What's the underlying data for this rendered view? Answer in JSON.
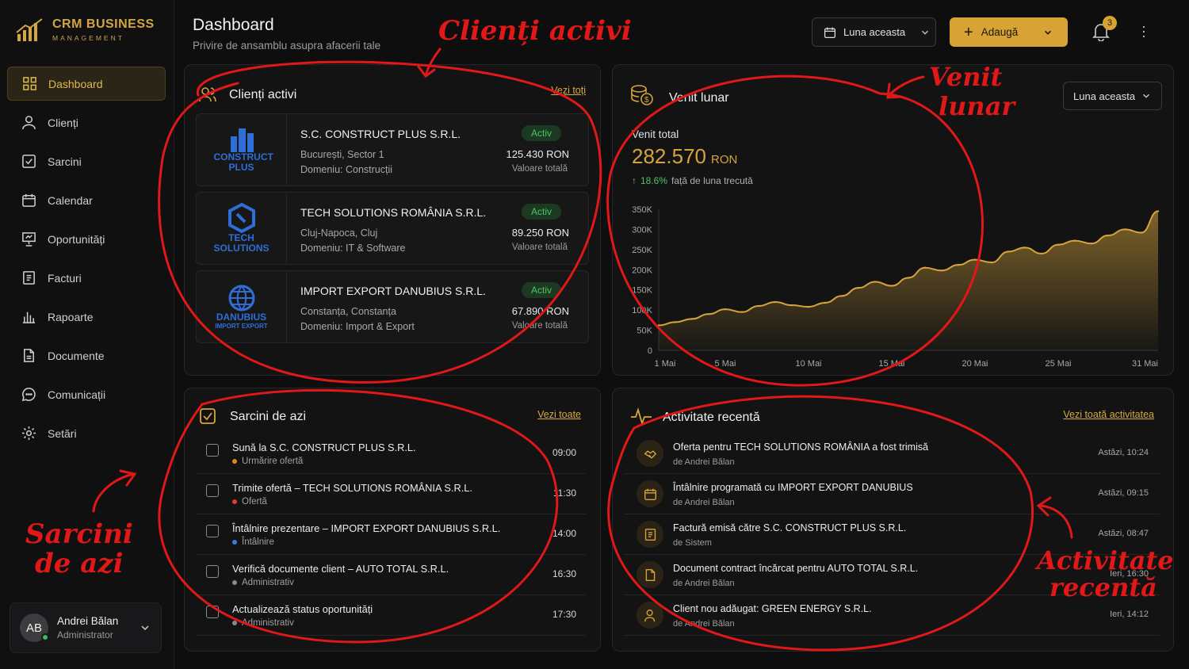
{
  "app": {
    "name": "CRM BUSINESS",
    "subtitle": "MANAGEMENT"
  },
  "nav": [
    {
      "label": "Dashboard",
      "icon": "dashboard-icon",
      "active": true
    },
    {
      "label": "Clienți",
      "icon": "user-icon"
    },
    {
      "label": "Sarcini",
      "icon": "checkbox-icon"
    },
    {
      "label": "Calendar",
      "icon": "calendar-icon"
    },
    {
      "label": "Oportunități",
      "icon": "presentation-icon"
    },
    {
      "label": "Facturi",
      "icon": "invoice-icon"
    },
    {
      "label": "Rapoarte",
      "icon": "bar-chart-icon"
    },
    {
      "label": "Documente",
      "icon": "document-icon"
    },
    {
      "label": "Comunicații",
      "icon": "chat-icon"
    },
    {
      "label": "Setări",
      "icon": "gear-icon"
    }
  ],
  "user": {
    "initials": "AB",
    "name": "Andrei Bălan",
    "role": "Administrator"
  },
  "header": {
    "title": "Dashboard",
    "subtitle": "Privire de ansamblu asupra afacerii tale",
    "period": "Luna aceasta",
    "add": "Adaugă",
    "notifications": "3"
  },
  "clients": {
    "title": "Clienți activi",
    "link": "Vezi toți",
    "items": [
      {
        "logo": "CONSTRUCT PLUS",
        "name": "S.C. CONSTRUCT PLUS S.R.L.",
        "location": "București, Sector 1",
        "domain": "Domeniu: Construcții",
        "status": "Activ",
        "value": "125.430 RON",
        "value_label": "Valoare totală"
      },
      {
        "logo": "TECH SOLUTIONS",
        "name": "TECH SOLUTIONS ROMÂNIA S.R.L.",
        "location": "Cluj-Napoca, Cluj",
        "domain": "Domeniu: IT & Software",
        "status": "Activ",
        "value": "89.250 RON",
        "value_label": "Valoare totală"
      },
      {
        "logo": "DANUBIUS",
        "logo_sub": "IMPORT EXPORT",
        "name": "IMPORT EXPORT DANUBIUS S.R.L.",
        "location": "Constanța, Constanța",
        "domain": "Domeniu: Import & Export",
        "status": "Activ",
        "value": "67.890 RON",
        "value_label": "Valoare totală"
      }
    ]
  },
  "revenue": {
    "title": "Venit lunar",
    "period": "Luna aceasta",
    "total_label": "Venit total",
    "total_value": "282.570",
    "currency": "RON",
    "change": "18.6%",
    "change_text": "față de luna trecută"
  },
  "chart_data": {
    "type": "area",
    "title": "",
    "xlabel": "",
    "ylabel": "",
    "ylim": [
      0,
      350000
    ],
    "yticks": [
      "350K",
      "300K",
      "250K",
      "200K",
      "150K",
      "100K",
      "50K",
      "0"
    ],
    "xticks": [
      "1 Mai",
      "5 Mai",
      "10 Mai",
      "15 Mai",
      "20 Mai",
      "25 Mai",
      "31 Mai"
    ],
    "x": [
      1,
      2,
      3,
      4,
      5,
      6,
      7,
      8,
      9,
      10,
      11,
      12,
      13,
      14,
      15,
      16,
      17,
      18,
      19,
      20,
      21,
      22,
      23,
      24,
      25,
      26,
      27,
      28,
      29,
      30,
      31
    ],
    "values": [
      62000,
      70000,
      78000,
      90000,
      102000,
      95000,
      110000,
      120000,
      112000,
      108000,
      118000,
      135000,
      155000,
      170000,
      160000,
      180000,
      205000,
      198000,
      212000,
      225000,
      218000,
      245000,
      255000,
      240000,
      262000,
      272000,
      265000,
      285000,
      300000,
      292000,
      345000
    ],
    "color": "#d6a43b",
    "grid": false
  },
  "tasks": {
    "title": "Sarcini de azi",
    "link": "Vezi toate",
    "items": [
      {
        "title": "Sună la S.C. CONSTRUCT PLUS S.R.L.",
        "category": "Urmărire ofertă",
        "color": "#e08a1e",
        "time": "09:00"
      },
      {
        "title": "Trimite ofertă – TECH SOLUTIONS ROMÂNIA S.R.L.",
        "category": "Ofertă",
        "color": "#e03a3a",
        "time": "11:30"
      },
      {
        "title": "Întâlnire prezentare – IMPORT EXPORT DANUBIUS S.R.L.",
        "category": "Întâlnire",
        "color": "#3a7ae0",
        "time": "14:00"
      },
      {
        "title": "Verifică documente client – AUTO TOTAL S.R.L.",
        "category": "Administrativ",
        "color": "#8a8a8a",
        "time": "16:30"
      },
      {
        "title": "Actualizează status oportunități",
        "category": "Administrativ",
        "color": "#8a8a8a",
        "time": "17:30"
      }
    ]
  },
  "activity": {
    "title": "Activitate recentă",
    "link": "Vezi toată activitatea",
    "items": [
      {
        "icon": "handshake-icon",
        "text": "Oferta pentru TECH SOLUTIONS ROMÂNIA a fost trimisă",
        "by": "de Andrei Bălan",
        "time": "Astăzi, 10:24"
      },
      {
        "icon": "calendar-icon",
        "text": "Întâlnire programată cu IMPORT EXPORT DANUBIUS",
        "by": "de Andrei Bălan",
        "time": "Astăzi, 09:15"
      },
      {
        "icon": "invoice-icon",
        "text": "Factură emisă către S.C. CONSTRUCT PLUS S.R.L.",
        "by": "de Sistem",
        "time": "Astăzi, 08:47"
      },
      {
        "icon": "document-icon",
        "text": "Document contract încărcat pentru AUTO TOTAL S.R.L.",
        "by": "de Andrei Bălan",
        "time": "Ieri, 16:30"
      },
      {
        "icon": "user-add-icon",
        "text": "Client nou adăugat: GREEN ENERGY S.R.L.",
        "by": "de Andrei Bălan",
        "time": "Ieri, 14:12"
      }
    ]
  },
  "annotations": {
    "clients": "Clienți activi",
    "revenue_1": "Venit",
    "revenue_2": "lunar",
    "tasks_1": "Sarcini",
    "tasks_2": "de azi",
    "activity_1": "Activitate",
    "activity_2": "recentă"
  }
}
